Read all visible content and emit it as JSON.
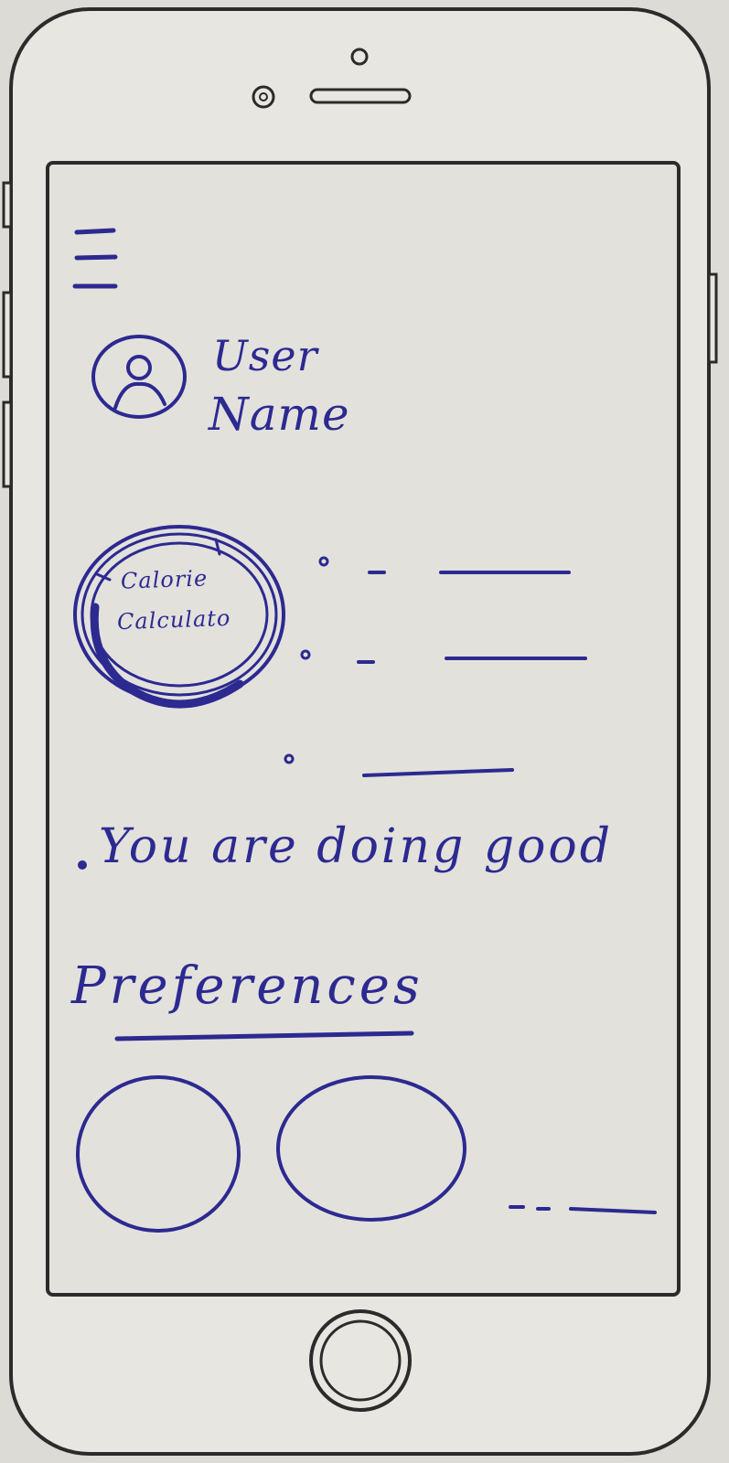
{
  "header": {
    "menu_icon": "hamburger-menu-icon"
  },
  "profile": {
    "avatar_icon": "user-avatar-icon",
    "name_line1": "User",
    "name_line2": "Name"
  },
  "calorie_widget": {
    "label_line1": "Calorie",
    "label_line2": "Calculato"
  },
  "summary_items": [
    {
      "placeholder": "bullet-line"
    },
    {
      "placeholder": "bullet-line"
    },
    {
      "placeholder": "bullet-line"
    }
  ],
  "status_message": "You are doing good",
  "preferences": {
    "heading": "Preferences",
    "items": [
      {
        "icon": "preference-circle"
      },
      {
        "icon": "preference-circle"
      }
    ],
    "more_indicator": "more-placeholder"
  },
  "device": {
    "home_button_icon": "home-button-icon"
  },
  "colors": {
    "ink": "#2c2a90",
    "paper": "#e6e4df",
    "outline": "#2b2b2b"
  }
}
